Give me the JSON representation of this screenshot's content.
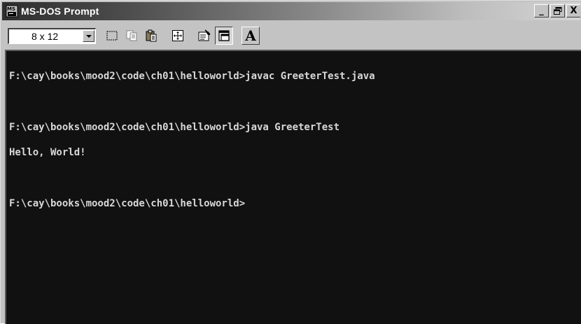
{
  "window": {
    "title": "MS-DOS Prompt",
    "controls": {
      "minimize": "_",
      "maximize": "□",
      "close": "X"
    }
  },
  "toolbar": {
    "font_size_value": "8 x 12",
    "buttons": [
      {
        "icon": "mark-icon"
      },
      {
        "icon": "copy-icon"
      },
      {
        "icon": "paste-icon"
      },
      {
        "icon": "fullscreen-icon"
      },
      {
        "icon": "properties-icon"
      },
      {
        "icon": "background-icon"
      },
      {
        "icon": "font-icon",
        "label": "A"
      }
    ]
  },
  "console": {
    "lines": [
      "F:\\cay\\books\\mood2\\code\\ch01\\helloworld>javac GreeterTest.java",
      "",
      "F:\\cay\\books\\mood2\\code\\ch01\\helloworld>java GreeterTest",
      "Hello, World!",
      "",
      "F:\\cay\\books\\mood2\\code\\ch01\\helloworld>"
    ]
  }
}
